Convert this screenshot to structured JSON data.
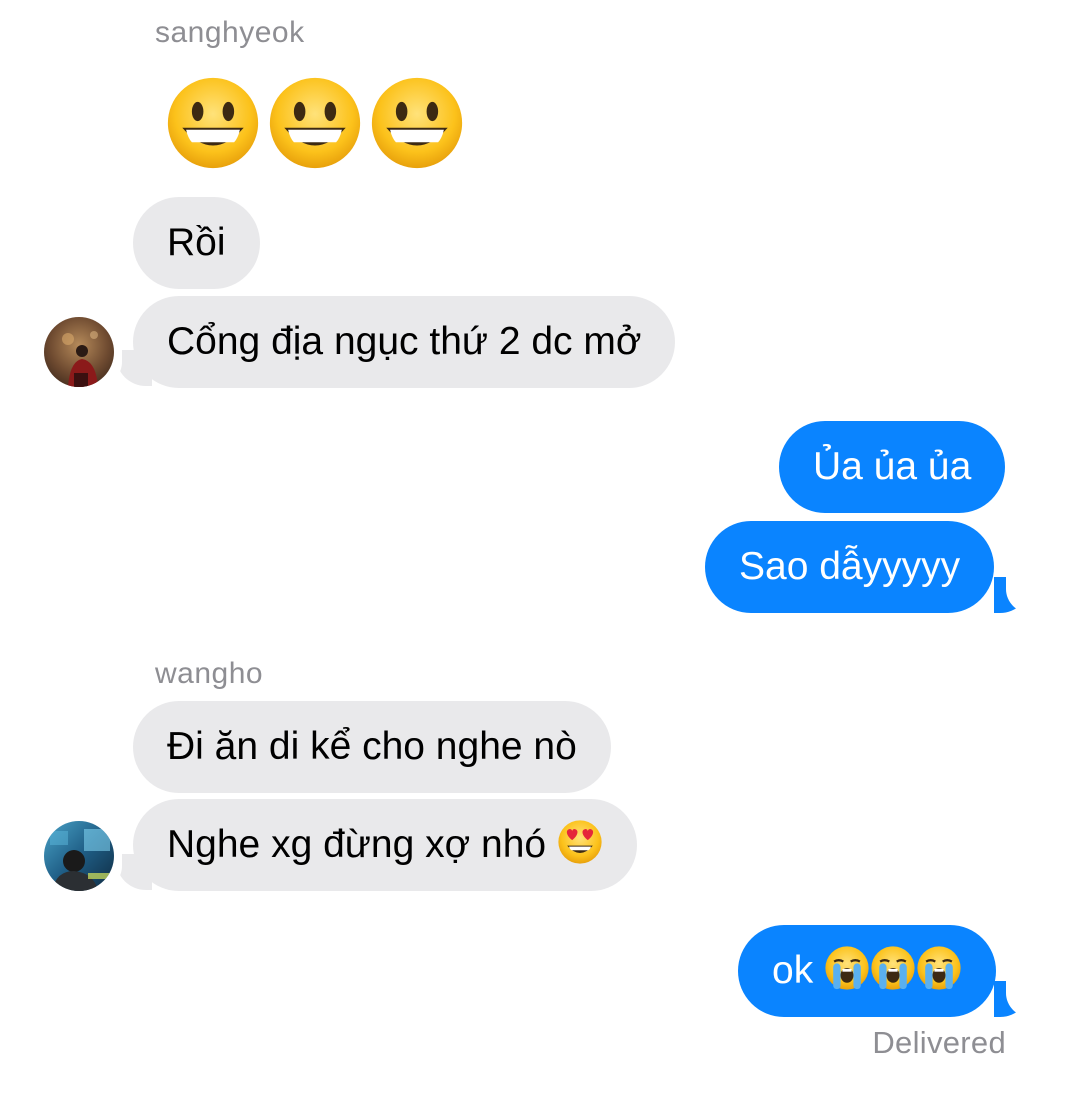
{
  "conversation": {
    "groups": [
      {
        "sender": "sanghyeok",
        "big_emoji": [
          "grinning-face-emoji",
          "grinning-face-emoji",
          "grinning-face-emoji"
        ],
        "messages": [
          {
            "text": "Rồi"
          },
          {
            "text": "Cổng địa ngục thứ 2 dc mở"
          }
        ]
      },
      {
        "sender": "me",
        "messages": [
          {
            "text": "Ủa ủa ủa"
          },
          {
            "text": "Sao dẫyyyyy"
          }
        ]
      },
      {
        "sender": "wangho",
        "messages": [
          {
            "text": "Đi ăn di kể cho nghe nò"
          },
          {
            "text": "Nghe xg đừng xợ nhó",
            "emoji": "heart-eyes-face-emoji"
          }
        ]
      },
      {
        "sender": "me",
        "messages": [
          {
            "text": "ok",
            "emoji": [
              "loudly-crying-face-emoji",
              "loudly-crying-face-emoji",
              "loudly-crying-face-emoji"
            ]
          }
        ]
      }
    ],
    "status": "Delivered"
  },
  "colors": {
    "incoming_bubble": "#e9e9eb",
    "outgoing_bubble": "#0a84ff",
    "meta_text": "#8e8e93"
  }
}
